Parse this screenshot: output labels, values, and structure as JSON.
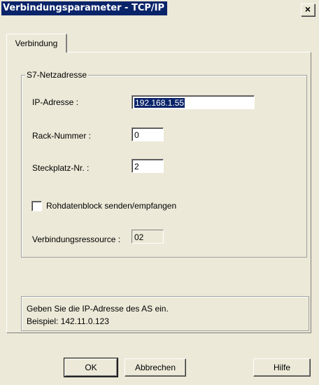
{
  "window": {
    "title": "Verbindungsparameter - TCP/IP",
    "close_label": "×"
  },
  "tabs": [
    {
      "label": "Verbindung",
      "active": true
    }
  ],
  "group": {
    "title": "S7-Netzadresse",
    "ip_label": "IP-Adresse :",
    "ip_value": "192.168.1.55",
    "rack_label": "Rack-Nummer :",
    "rack_value": "0",
    "slot_label": "Steckplatz-Nr. :",
    "slot_value": "2",
    "checkbox_label": "Rohdatenblock senden/empfangen",
    "checkbox_checked": false,
    "resource_label": "Verbindungsressource :",
    "resource_value": "02"
  },
  "hint": {
    "line1": "Geben Sie die IP-Adresse des AS ein.",
    "line2": "Beispiel: 142.11.0.123"
  },
  "buttons": {
    "ok": "OK",
    "cancel": "Abbrechen",
    "help": "Hilfe"
  }
}
